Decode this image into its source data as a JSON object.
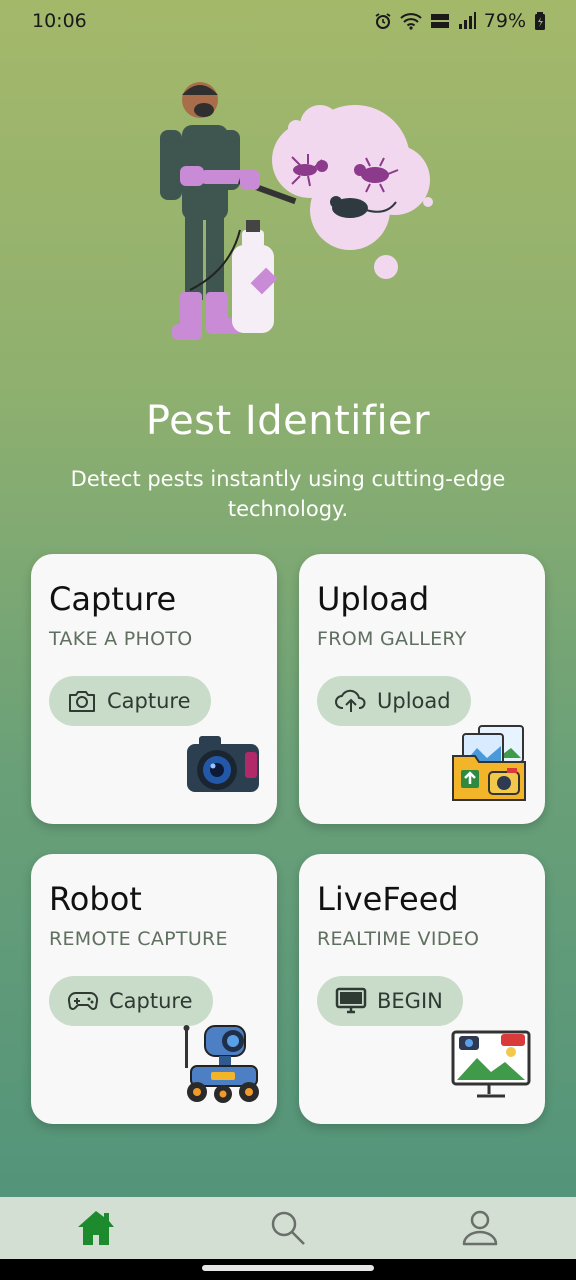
{
  "status_bar": {
    "time": "10:06",
    "battery": "79%",
    "icons": [
      "alarm-icon",
      "wifi-icon",
      "volte-icon",
      "signal-icon",
      "battery-icon"
    ]
  },
  "app": {
    "title": "Pest Identifier",
    "subtitle": "Detect pests instantly using cutting-edge technology."
  },
  "cards": [
    {
      "title": "Capture",
      "subtitle": "TAKE A PHOTO",
      "button": "Capture",
      "button_icon": "camera-icon",
      "illustration": "camera-illustration"
    },
    {
      "title": "Upload",
      "subtitle": "FROM GALLERY",
      "button": "Upload",
      "button_icon": "cloud-upload-icon",
      "illustration": "gallery-folder-illustration"
    },
    {
      "title": "Robot",
      "subtitle": "REMOTE CAPTURE",
      "button": "Capture",
      "button_icon": "gamepad-icon",
      "illustration": "robot-rover-illustration"
    },
    {
      "title": "LiveFeed",
      "subtitle": "REALTIME VIDEO",
      "button": "BEGIN",
      "button_icon": "monitor-icon",
      "illustration": "live-monitor-illustration"
    }
  ],
  "bottom_nav": {
    "items": [
      "home-icon",
      "search-icon",
      "profile-icon"
    ],
    "active": "home-icon"
  },
  "colors": {
    "accent": "#1e8a2e",
    "button_bg": "#c9dcc9",
    "card_bg": "#f8f8f8"
  }
}
